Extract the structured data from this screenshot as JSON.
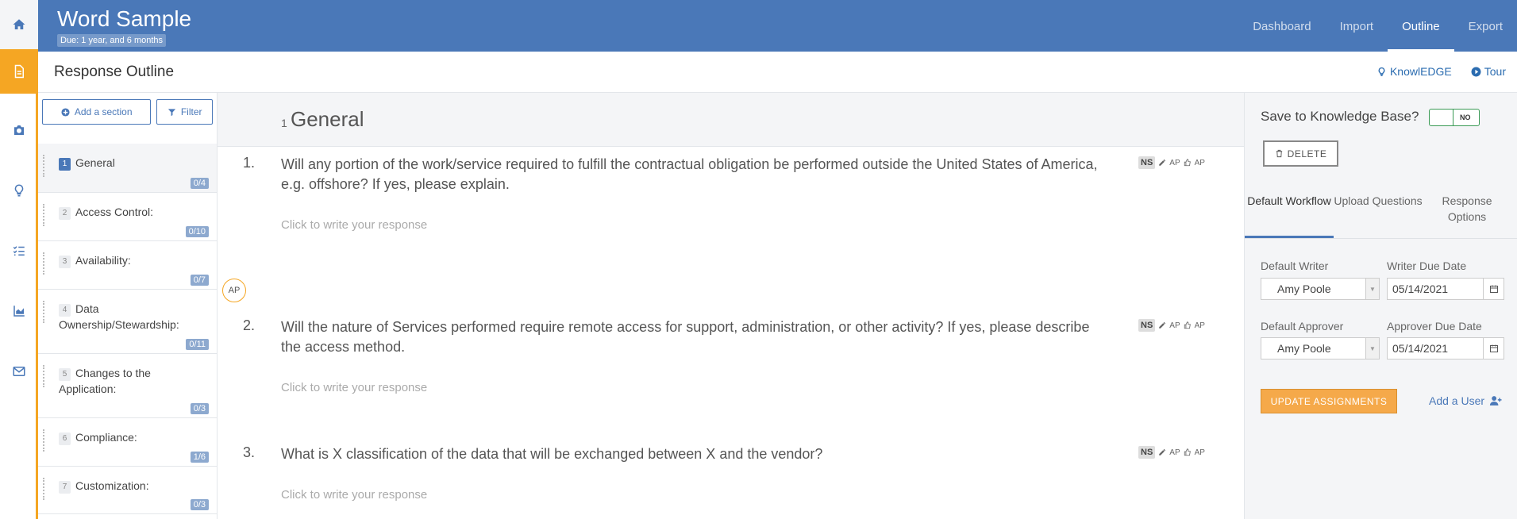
{
  "header": {
    "title": "Word Sample",
    "due": "Due: 1 year, and 6 months",
    "nav": [
      "Dashboard",
      "Import",
      "Outline",
      "Export"
    ],
    "active_nav": "Outline"
  },
  "subheader": {
    "title": "Response Outline",
    "links": {
      "knowledge": "KnowlEDGE",
      "tour": "Tour"
    }
  },
  "sidebar": {
    "add_section": "Add a section",
    "filter": "Filter",
    "items": [
      {
        "num": "1",
        "label": "General",
        "count": "0/4"
      },
      {
        "num": "2",
        "label": "Access Control:",
        "count": "0/10"
      },
      {
        "num": "3",
        "label": "Availability:",
        "count": "0/7"
      },
      {
        "num": "4",
        "label": "Data Ownership/Stewardship:",
        "count": "0/11"
      },
      {
        "num": "5",
        "label": "Changes to the Application:",
        "count": "0/3"
      },
      {
        "num": "6",
        "label": "Compliance:",
        "count": "1/6"
      },
      {
        "num": "7",
        "label": "Customization:",
        "count": "0/3"
      }
    ]
  },
  "main": {
    "section_num": "1",
    "section_title": "General",
    "response_placeholder": "Click to write your response",
    "ns": "NS",
    "ap": "AP",
    "avatar": "AP",
    "questions": [
      {
        "num": "1.",
        "text": "Will any portion of the work/service required to fulfill the contractual obligation be performed outside the United States of America, e.g. offshore? If yes, please explain."
      },
      {
        "num": "2.",
        "text": "Will the nature of Services performed require remote access for support, administration, or other activity? If yes, please describe the access method."
      },
      {
        "num": "3.",
        "text": "What is X classification of the data that will be exchanged between X and the vendor?"
      }
    ]
  },
  "panel": {
    "kb_label": "Save to Knowledge Base?",
    "toggle": "NO",
    "delete": "DELETE",
    "tabs": [
      "Default Workflow",
      "Upload Questions",
      "Response Options"
    ],
    "writer_label": "Default Writer",
    "writer": "Amy Poole",
    "writer_due_label": "Writer Due Date",
    "writer_due": "05/14/2021",
    "approver_label": "Default Approver",
    "approver": "Amy Poole",
    "approver_due_label": "Approver Due Date",
    "approver_due": "05/14/2021",
    "update": "UPDATE ASSIGNMENTS",
    "add_user": "Add a User"
  },
  "colors": {
    "brand": "#4a78b8",
    "accent": "#f5a623"
  }
}
